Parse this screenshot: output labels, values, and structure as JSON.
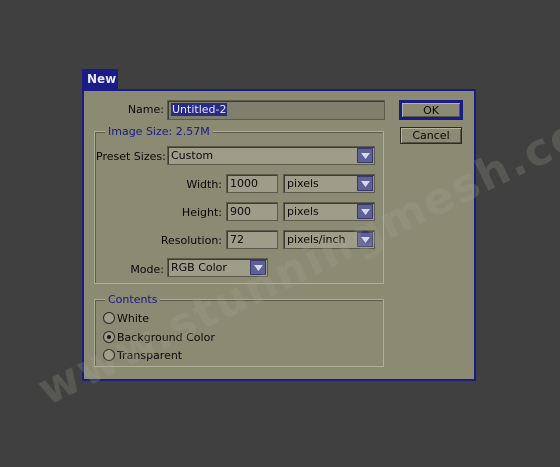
{
  "dialog": {
    "title": "New",
    "name_label": "Name:",
    "name_value": "Untitled-2",
    "ok_label": "OK",
    "cancel_label": "Cancel",
    "image_size_legend": "Image Size: 2.57M",
    "preset_label": "Preset Sizes:",
    "preset_value": "Custom",
    "width_label": "Width:",
    "width_value": "1000",
    "width_unit": "pixels",
    "height_label": "Height:",
    "height_value": "900",
    "height_unit": "pixels",
    "resolution_label": "Resolution:",
    "resolution_value": "72",
    "resolution_unit": "pixels/inch",
    "mode_label": "Mode:",
    "mode_value": "RGB Color",
    "contents_legend": "Contents",
    "contents_options": [
      {
        "label": "White",
        "selected": false
      },
      {
        "label": "Background Color",
        "selected": true
      },
      {
        "label": "Transparent",
        "selected": false
      }
    ]
  },
  "watermark": "www.stunningmesh.com",
  "colors": {
    "background": "#404040",
    "dialog": "#8b8a73",
    "accent": "#1b1b86"
  },
  "icons": [
    "chevron-down-icon",
    "radio-icon"
  ]
}
